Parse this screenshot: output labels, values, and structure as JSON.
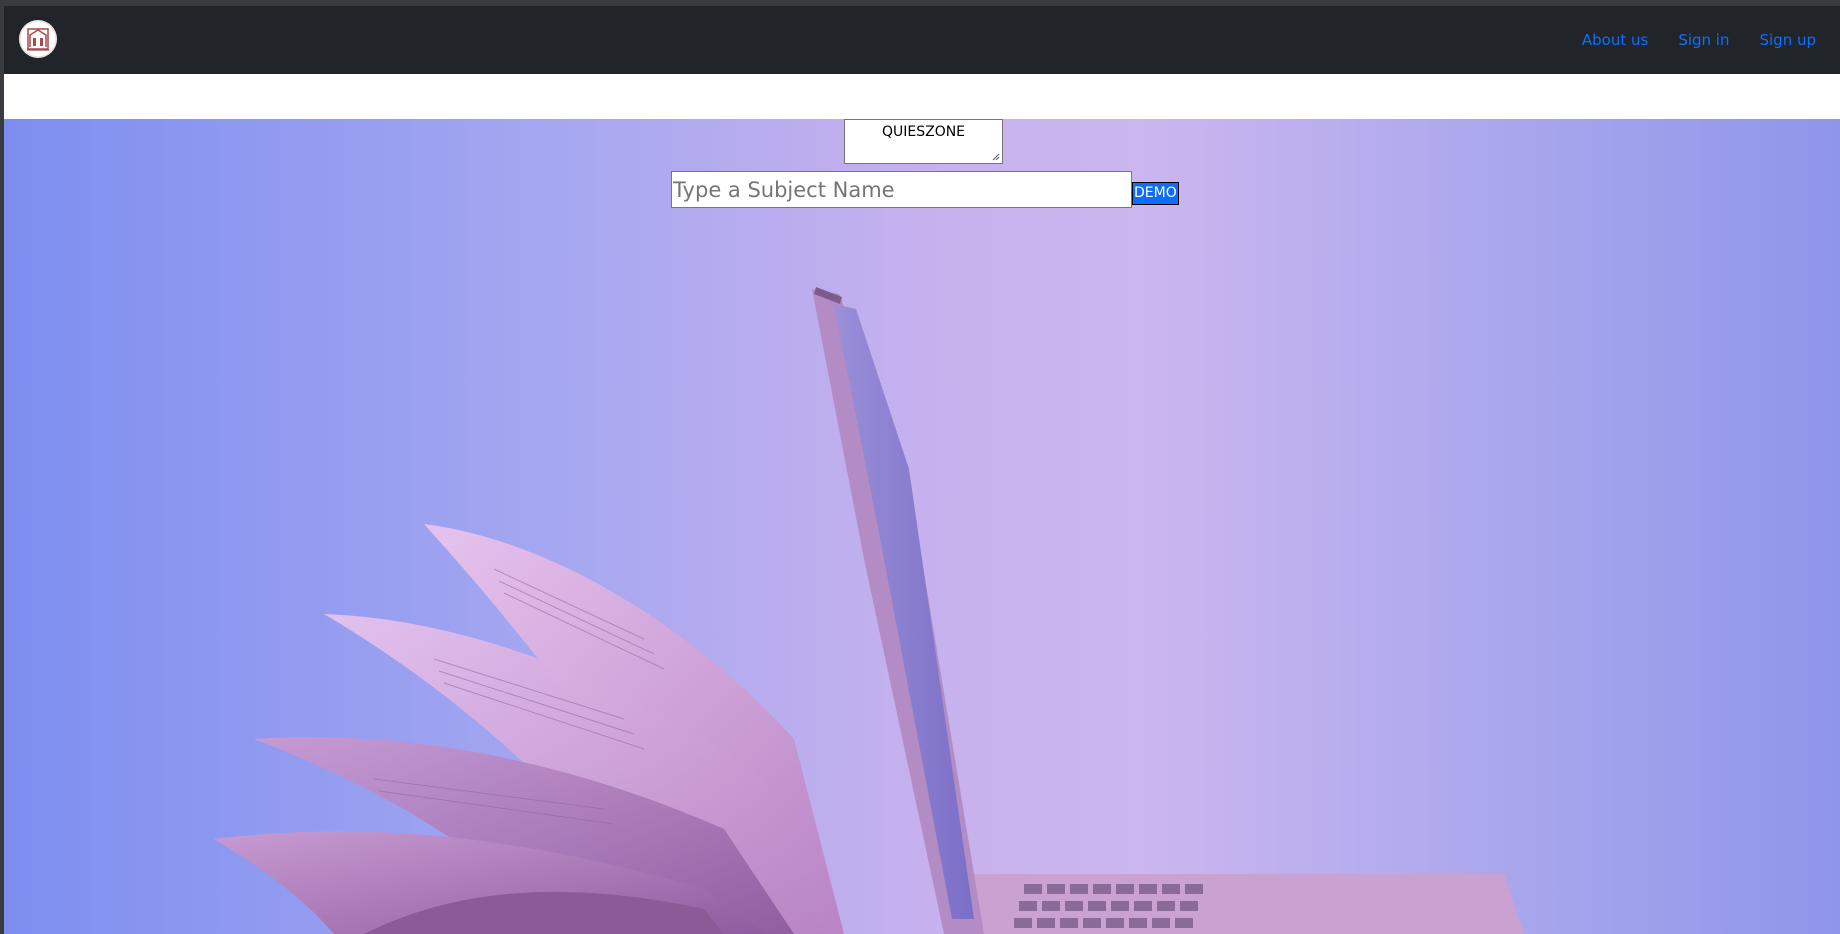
{
  "navbar": {
    "logo_icon": "institution-emblem-icon",
    "links": [
      {
        "label": "About us"
      },
      {
        "label": "Sign in"
      },
      {
        "label": "Sign up"
      }
    ],
    "link_color": "#0d6efd",
    "background": "#212529"
  },
  "hero": {
    "title_box_text": "QUIESZONE",
    "search": {
      "placeholder": "Type a Subject Name",
      "value": ""
    },
    "demo_button_label": "DEMO",
    "background_image": "open-book-and-laptop-photo"
  }
}
